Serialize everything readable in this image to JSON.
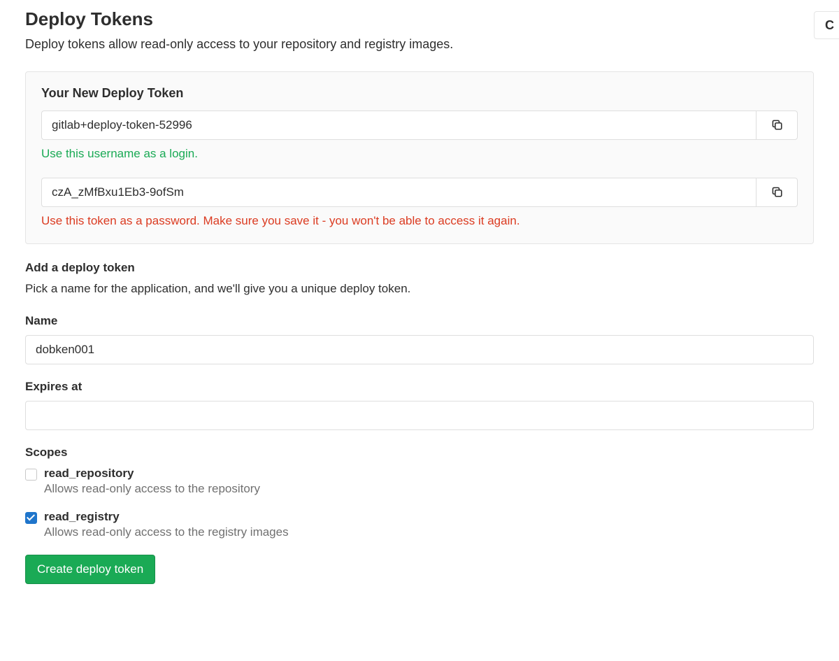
{
  "header": {
    "title": "Deploy Tokens",
    "description": "Deploy tokens allow read-only access to your repository and registry images.",
    "corner_label": "C"
  },
  "new_token": {
    "panel_title": "Your New Deploy Token",
    "username_value": "gitlab+deploy-token-52996",
    "username_hint": "Use this username as a login.",
    "token_value": "czA_zMfBxu1Eb3-9ofSm",
    "token_hint": "Use this token as a password. Make sure you save it - you won't be able to access it again."
  },
  "form": {
    "section_title": "Add a deploy token",
    "section_desc": "Pick a name for the application, and we'll give you a unique deploy token.",
    "name_label": "Name",
    "name_value": "dobken001",
    "expires_label": "Expires at",
    "expires_value": "",
    "scopes_label": "Scopes",
    "scopes": [
      {
        "name": "read_repository",
        "desc": "Allows read-only access to the repository",
        "checked": false
      },
      {
        "name": "read_registry",
        "desc": "Allows read-only access to the registry images",
        "checked": true
      }
    ],
    "submit_label": "Create deploy token"
  }
}
